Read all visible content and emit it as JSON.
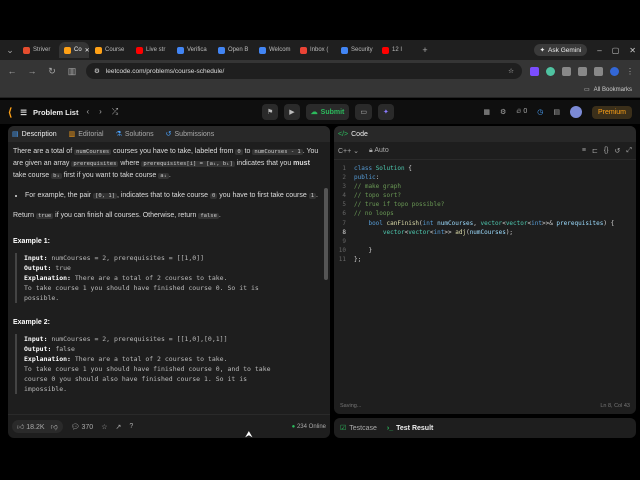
{
  "browser": {
    "tabs": [
      {
        "label": "Striver",
        "color": "#e54d2e"
      },
      {
        "label": "Co",
        "color": "#ffa116",
        "active": true
      },
      {
        "label": "Course",
        "color": "#ffa116"
      },
      {
        "label": "Live str",
        "color": "#ff0000"
      },
      {
        "label": "Verifica",
        "color": "#4285f4"
      },
      {
        "label": "Open B",
        "color": "#4285f4"
      },
      {
        "label": "Welcom",
        "color": "#4285f4"
      },
      {
        "label": "Inbox (",
        "color": "#ea4335"
      },
      {
        "label": "Security",
        "color": "#4285f4"
      },
      {
        "label": "12 I",
        "color": "#ff0000"
      }
    ],
    "ask_gemini": "Ask Gemini",
    "url": "leetcode.com/problems/course-schedule/",
    "all_bookmarks": "All Bookmarks"
  },
  "header": {
    "problem_list": "Problem List",
    "submit": "Submit",
    "streak": "0",
    "premium": "Premium"
  },
  "left_panel": {
    "tabs": [
      "Description",
      "Editorial",
      "Solutions",
      "Submissions"
    ],
    "desc": {
      "p1a": "There are a total of ",
      "p1code1": "numCourses",
      "p1b": " courses you have to take, labeled from ",
      "p1code2": "0",
      "p1c": " to ",
      "p1code3": "numCourses - 1",
      "p1d": ". You are given an array ",
      "p1code4": "prerequisites",
      "p1e": " where ",
      "p1code5": "prerequisites[i] = [aᵢ, bᵢ]",
      "p1f": " indicates that you ",
      "p1must": "must",
      "p1g": " take course ",
      "p1code6": "bᵢ",
      "p1h": " first if you want to take course ",
      "p1code7": "aᵢ",
      "p1i": ".",
      "b1a": "For example, the pair ",
      "b1code1": "[0, 1]",
      "b1b": ", indicates that to take course ",
      "b1code2": "0",
      "b1c": " you have to first take course ",
      "b1code3": "1",
      "b1d": ".",
      "p2a": "Return ",
      "p2code1": "true",
      "p2b": " if you can finish all courses. Otherwise, return ",
      "p2code2": "false",
      "p2c": "."
    },
    "examples": [
      {
        "title": "Example 1:",
        "input_label": "Input:",
        "input": " numCourses = 2, prerequisites = [[1,0]]",
        "output_label": "Output:",
        "output": " true",
        "expl_label": "Explanation:",
        "expl": [
          " There are a total of 2 courses to take.",
          "To take course 1 you should have finished course 0. So it is",
          "possible."
        ]
      },
      {
        "title": "Example 2:",
        "input_label": "Input:",
        "input": " numCourses = 2, prerequisites = [[1,0],[0,1]]",
        "output_label": "Output:",
        "output": " false",
        "expl_label": "Explanation:",
        "expl": [
          " There are a total of 2 courses to take.",
          "To take course 1 you should have finished course 0, and to take",
          "course 0 you should also have finished course 1. So it is",
          "impossible."
        ]
      }
    ],
    "footer": {
      "likes": "18.2K",
      "comments": "370",
      "online": "234 Online"
    }
  },
  "right_panel": {
    "title": "Code",
    "language": "C++",
    "mode": "Auto",
    "status_left": "Saving...",
    "status_right": "Ln 8, Col 43",
    "bottom_tabs": [
      "Testcase",
      "Test Result"
    ]
  },
  "code_lines": [
    {
      "n": "1",
      "parts": [
        [
          "kw",
          "class"
        ],
        [
          "tx",
          " "
        ],
        [
          "ty",
          "Solution"
        ],
        [
          "tx",
          " {"
        ]
      ]
    },
    {
      "n": "2",
      "parts": [
        [
          "kw",
          "public"
        ],
        [
          "tx",
          ":"
        ]
      ]
    },
    {
      "n": "3",
      "parts": [
        [
          "cm",
          "// make graph"
        ]
      ]
    },
    {
      "n": "4",
      "parts": [
        [
          "cm",
          "// topo sort?"
        ]
      ]
    },
    {
      "n": "5",
      "parts": [
        [
          "cm",
          "// true if topo possible?"
        ]
      ]
    },
    {
      "n": "6",
      "parts": [
        [
          "cm",
          "// no loops"
        ]
      ]
    },
    {
      "n": "7",
      "parts": [
        [
          "tx",
          "    "
        ],
        [
          "kw",
          "bool"
        ],
        [
          "tx",
          " "
        ],
        [
          "fn",
          "canFinish"
        ],
        [
          "tx",
          "("
        ],
        [
          "kw",
          "int"
        ],
        [
          "tx",
          " "
        ],
        [
          "va",
          "numCourses"
        ],
        [
          "tx",
          ", "
        ],
        [
          "ty",
          "vector"
        ],
        [
          "tx",
          "<"
        ],
        [
          "ty",
          "vector"
        ],
        [
          "tx",
          "<"
        ],
        [
          "kw",
          "int"
        ],
        [
          "tx",
          ">>& "
        ],
        [
          "va",
          "prerequisites"
        ],
        [
          "tx",
          ") {"
        ]
      ]
    },
    {
      "n": "8",
      "cur": true,
      "parts": [
        [
          "tx",
          "        "
        ],
        [
          "ty",
          "vector"
        ],
        [
          "tx",
          "<"
        ],
        [
          "ty",
          "vector"
        ],
        [
          "tx",
          "<"
        ],
        [
          "kw",
          "int"
        ],
        [
          "tx",
          ">> "
        ],
        [
          "fn",
          "adj"
        ],
        [
          "tx",
          "("
        ],
        [
          "va",
          "numCourses"
        ],
        [
          "tx",
          ");"
        ]
      ]
    },
    {
      "n": "9",
      "parts": []
    },
    {
      "n": "10",
      "parts": [
        [
          "tx",
          "    }"
        ]
      ]
    },
    {
      "n": "11",
      "parts": [
        [
          "tx",
          "};"
        ]
      ]
    }
  ]
}
